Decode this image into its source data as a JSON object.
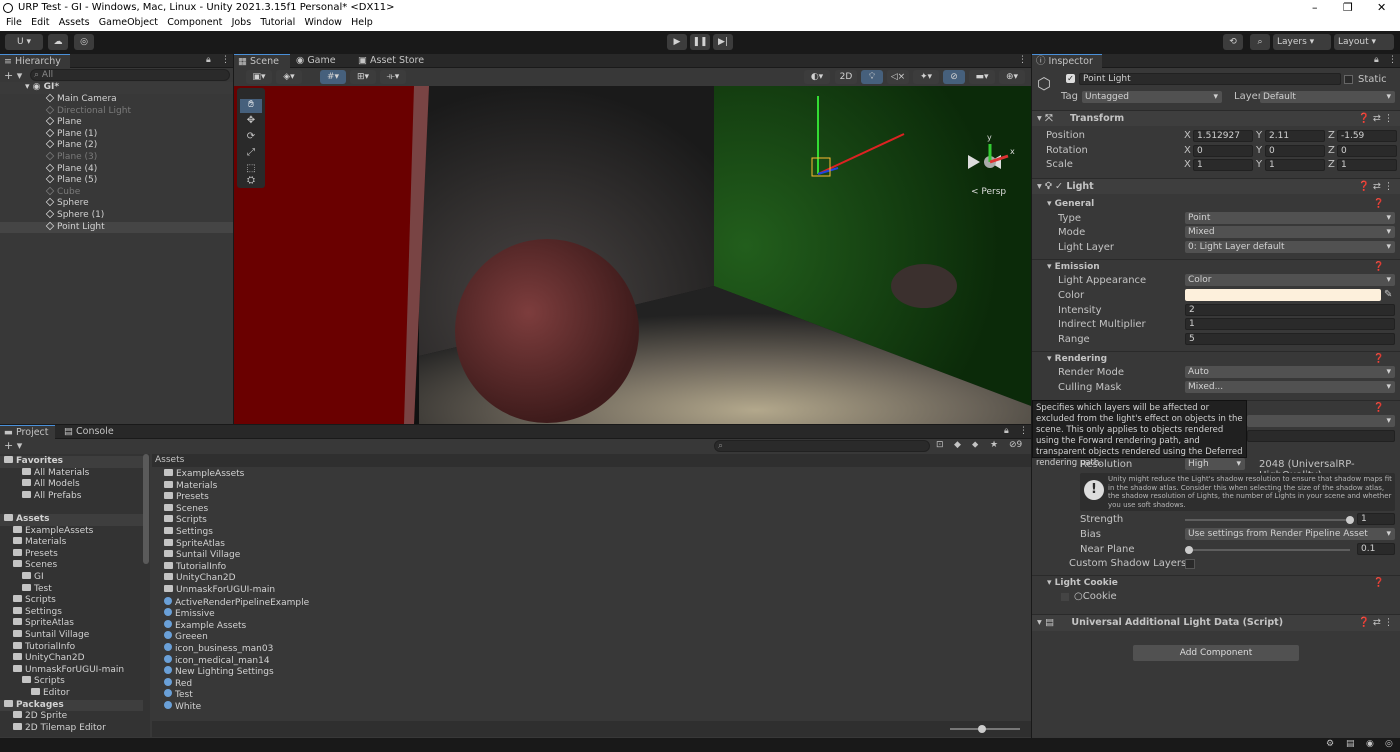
{
  "window": {
    "title": "URP Test - GI - Windows, Mac, Linux - Unity 2021.3.15f1 Personal* <DX11>",
    "controls": [
      "–",
      "❐",
      "✕"
    ]
  },
  "menu": [
    "File",
    "Edit",
    "Assets",
    "GameObject",
    "Component",
    "Jobs",
    "Tutorial",
    "Window",
    "Help"
  ],
  "toolbar": {
    "account": "U ▾",
    "layers": "Layers",
    "layout": "Layout"
  },
  "hierarchy": {
    "tab": "Hierarchy",
    "search_placeholder": "All",
    "scene": "GI*",
    "items": [
      {
        "label": "Main Camera",
        "dim": false
      },
      {
        "label": "Directional Light",
        "dim": true
      },
      {
        "label": "Plane",
        "dim": false
      },
      {
        "label": "Plane (1)",
        "dim": false
      },
      {
        "label": "Plane (2)",
        "dim": false
      },
      {
        "label": "Plane (3)",
        "dim": true
      },
      {
        "label": "Plane (4)",
        "dim": false
      },
      {
        "label": "Plane (5)",
        "dim": false
      },
      {
        "label": "Cube",
        "dim": true
      },
      {
        "label": "Sphere",
        "dim": false
      },
      {
        "label": "Sphere (1)",
        "dim": false
      },
      {
        "label": "Point Light",
        "dim": false
      }
    ]
  },
  "scene_tabs": [
    "Scene",
    "Game",
    "Asset Store"
  ],
  "scene": {
    "mode2d": "2D",
    "persp": "< Persp",
    "gizmo_y": "y",
    "gizmo_x": "x"
  },
  "project": {
    "tabs": [
      "Project",
      "Console"
    ],
    "hidden_count": "9",
    "left_items": [
      {
        "label": "Favorites",
        "indent": 0,
        "bold": true
      },
      {
        "label": "All Materials",
        "indent": 2
      },
      {
        "label": "All Models",
        "indent": 2
      },
      {
        "label": "All Prefabs",
        "indent": 2
      },
      {
        "label": "",
        "indent": 0
      },
      {
        "label": "Assets",
        "indent": 0,
        "bold": true
      },
      {
        "label": "ExampleAssets",
        "indent": 1
      },
      {
        "label": "Materials",
        "indent": 1
      },
      {
        "label": "Presets",
        "indent": 1
      },
      {
        "label": "Scenes",
        "indent": 1
      },
      {
        "label": "GI",
        "indent": 2
      },
      {
        "label": "Test",
        "indent": 2
      },
      {
        "label": "Scripts",
        "indent": 1
      },
      {
        "label": "Settings",
        "indent": 1
      },
      {
        "label": "SpriteAtlas",
        "indent": 1
      },
      {
        "label": "Suntail Village",
        "indent": 1
      },
      {
        "label": "TutorialInfo",
        "indent": 1
      },
      {
        "label": "UnityChan2D",
        "indent": 1
      },
      {
        "label": "UnmaskForUGUI-main",
        "indent": 1
      },
      {
        "label": "Scripts",
        "indent": 2
      },
      {
        "label": "Editor",
        "indent": 3
      },
      {
        "label": "Packages",
        "indent": 0,
        "bold": true
      },
      {
        "label": "2D Sprite",
        "indent": 1
      },
      {
        "label": "2D Tilemap Editor",
        "indent": 1
      }
    ],
    "breadcrumb": "Assets",
    "right_items": [
      "ExampleAssets",
      "Materials",
      "Presets",
      "Scenes",
      "Scripts",
      "Settings",
      "SpriteAtlas",
      "Suntail Village",
      "TutorialInfo",
      "UnityChan2D",
      "UnmaskForUGUI-main",
      "ActiveRenderPipelineExample",
      "Emissive",
      "Example Assets",
      "Greeen",
      "icon_business_man03",
      "icon_medical_man14",
      "New Lighting Settings",
      "Red",
      "Test",
      "White"
    ]
  },
  "inspector": {
    "tab": "Inspector",
    "object_name": "Point Light",
    "static": "Static",
    "tag_label": "Tag",
    "tag": "Untagged",
    "layer_label": "Layer",
    "layer": "Default",
    "transform": {
      "title": "Transform",
      "position": {
        "label": "Position",
        "x": "1.512927",
        "y": "2.11",
        "z": "-1.59"
      },
      "rotation": {
        "label": "Rotation",
        "x": "0",
        "y": "0",
        "z": "0"
      },
      "scale": {
        "label": "Scale",
        "x": "1",
        "y": "1",
        "z": "1"
      }
    },
    "light": {
      "title": "Light",
      "general": "General",
      "type_label": "Type",
      "type": "Point",
      "mode_label": "Mode",
      "mode": "Mixed",
      "layer_label": "Light Layer",
      "layer": "0: Light Layer default",
      "emission": "Emission",
      "appearance_label": "Light Appearance",
      "appearance": "Color",
      "color_label": "Color",
      "color": "#fdf0dc",
      "intensity_label": "Intensity",
      "intensity": "2",
      "indirect_label": "Indirect Multiplier",
      "indirect": "1",
      "range_label": "Range",
      "range": "5",
      "rendering": "Rendering",
      "render_mode_label": "Render Mode",
      "render_mode": "Auto",
      "culling_label": "Culling Mask",
      "culling": "Mixed...",
      "resolution_label": "Resolution",
      "resolution": "High",
      "resolution_value": "2048 (UniversalRP-HighQuality)",
      "warning": "Unity might reduce the Light's shadow resolution to ensure that shadow maps fit in the shadow atlas. Consider this when selecting the size of the shadow atlas, the shadow resolution of Lights, the number of Lights in your scene and whether you use soft shadows.",
      "strength_label": "Strength",
      "strength": "1",
      "strength_fraction": 1.0,
      "bias_label": "Bias",
      "bias": "Use settings from Render Pipeline Asset",
      "near_label": "Near Plane",
      "near": "0.1",
      "near_fraction": 0.0,
      "custom_shadow_label": "Custom Shadow Layers",
      "cookie_title": "Light Cookie",
      "cookie_label": "Cookie"
    },
    "script_title": "Universal Additional Light Data (Script)",
    "add_component": "Add Component",
    "tooltip": "Specifies which layers will be affected or excluded from the light's effect on objects in the scene. This only applies to objects rendered using the Forward rendering path, and transparent objects rendered using the Deferred rendering path."
  }
}
